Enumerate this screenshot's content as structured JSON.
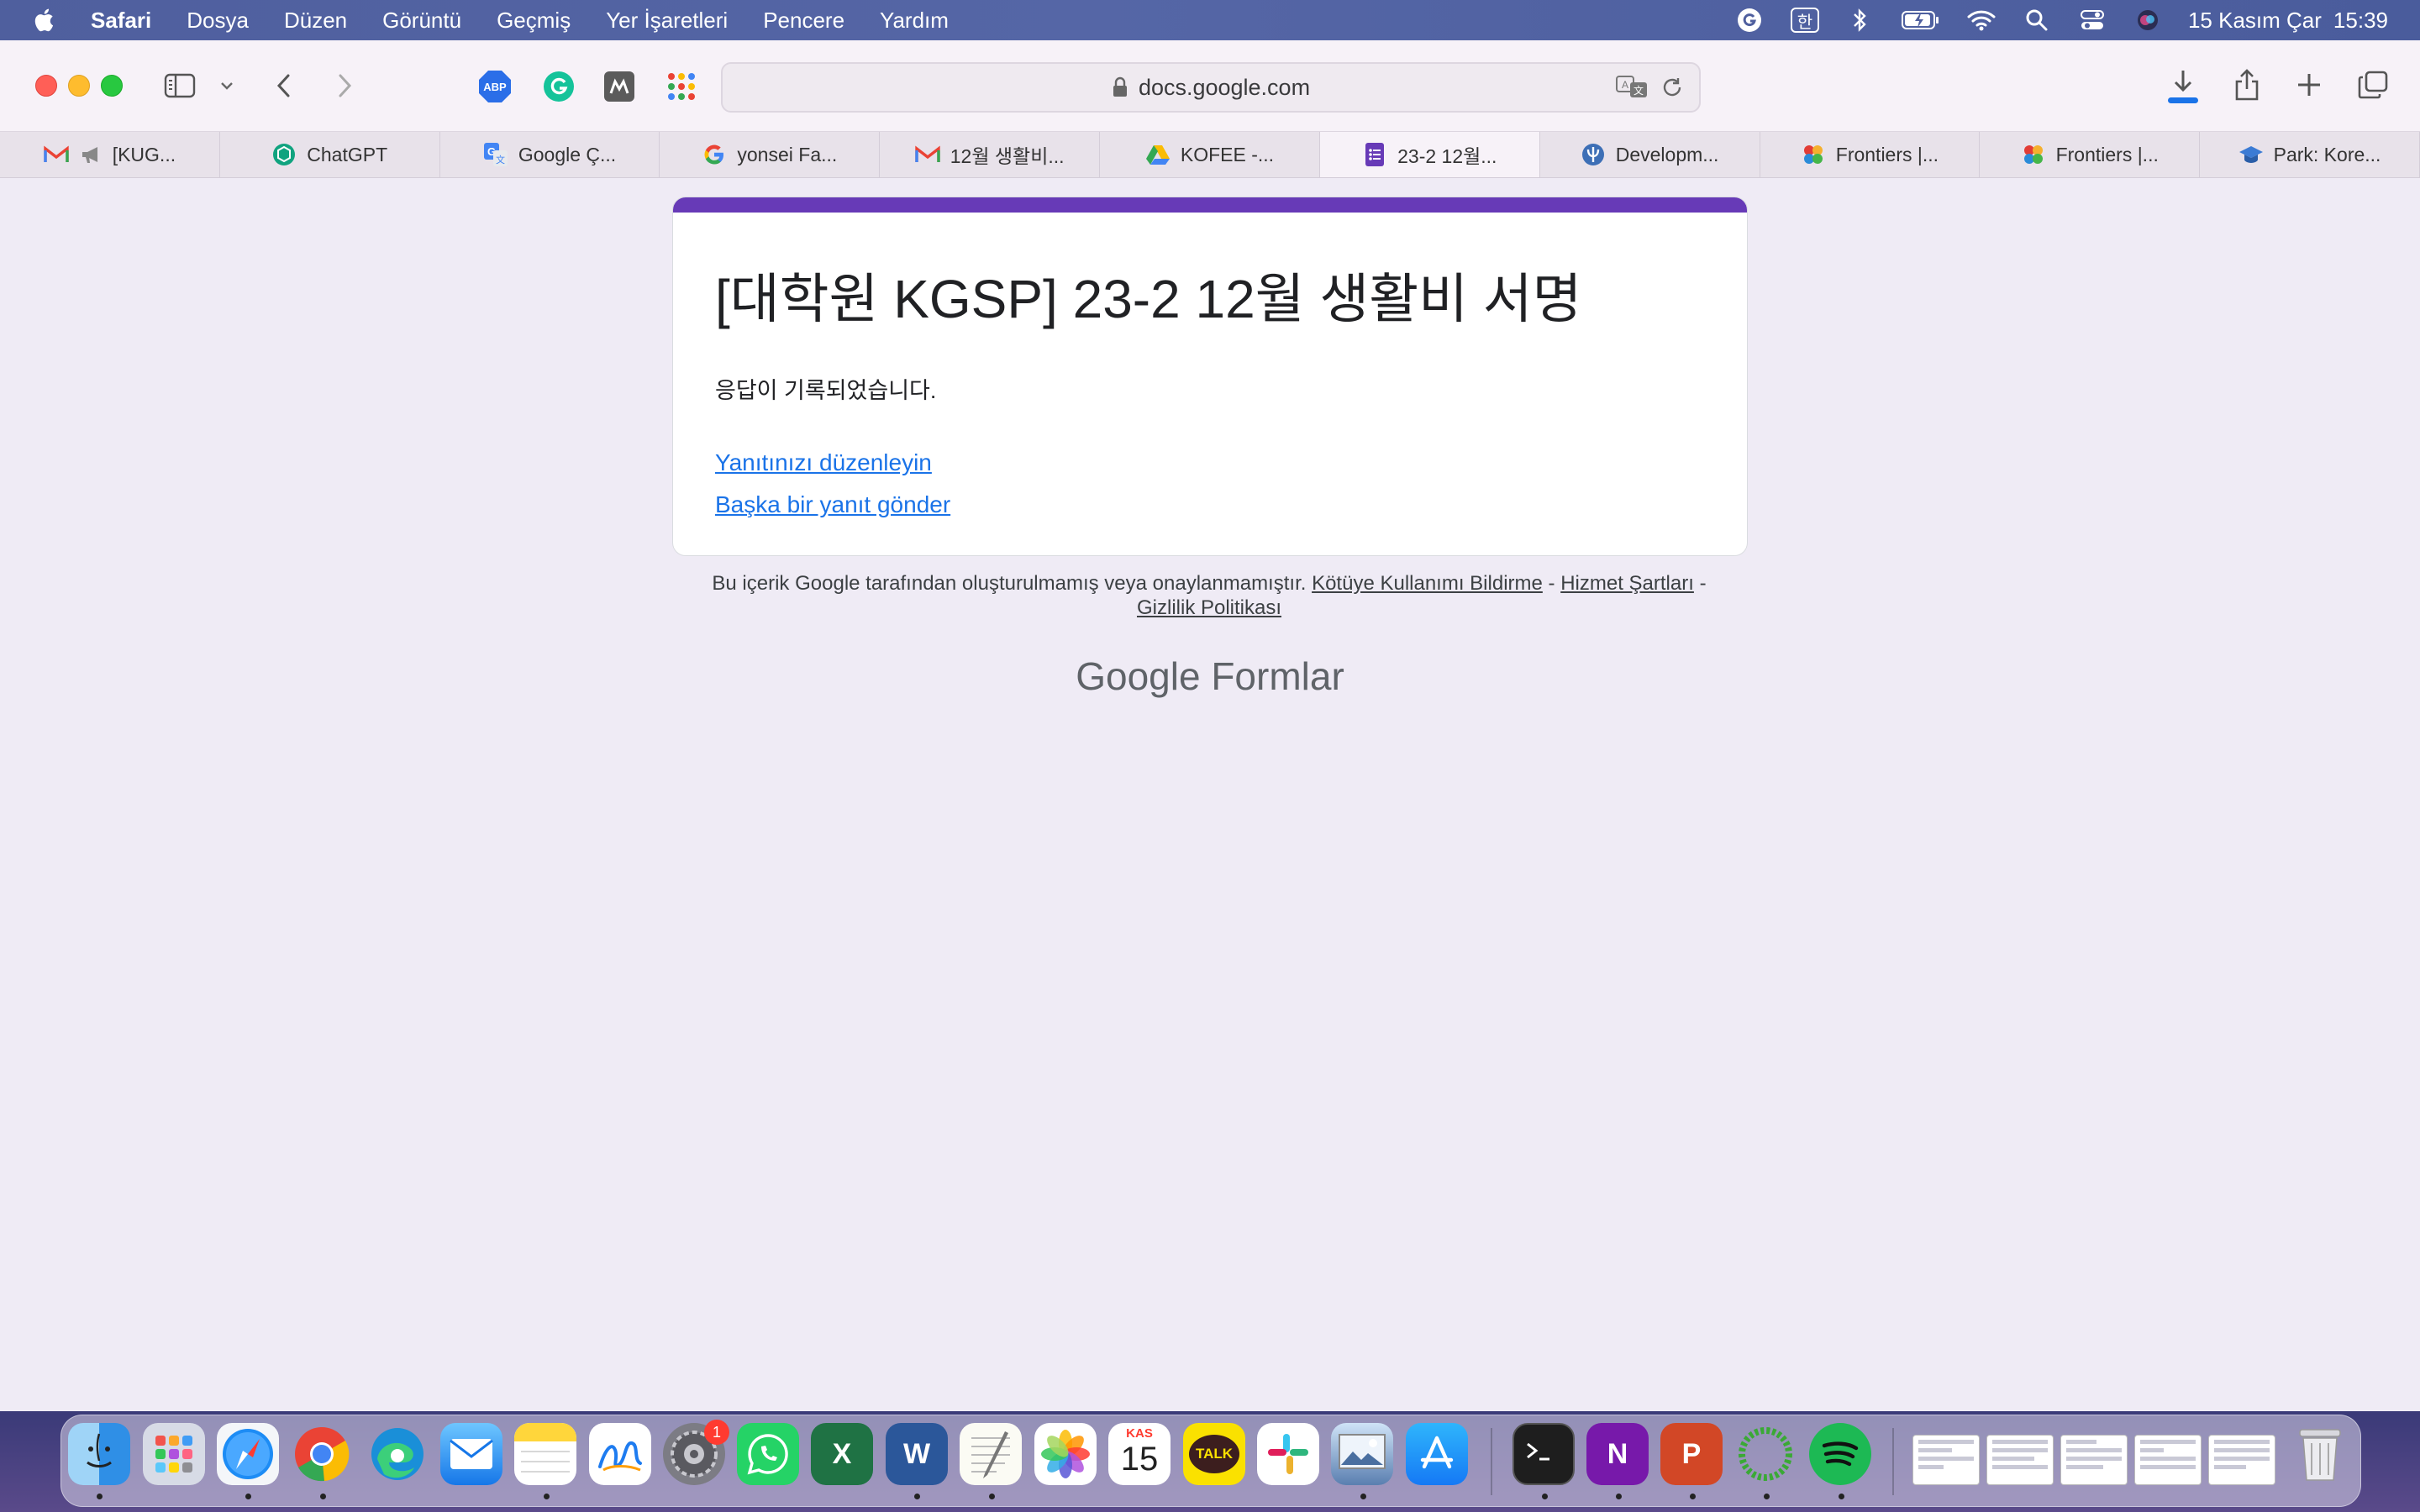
{
  "menubar": {
    "app_name": "Safari",
    "items": [
      "Dosya",
      "Düzen",
      "Görüntü",
      "Geçmiş",
      "Yer İşaretleri",
      "Pencere",
      "Yardım"
    ],
    "input_source": "한",
    "date": "15 Kasım Çar",
    "time": "15:39"
  },
  "toolbar": {
    "url": "docs.google.com",
    "extensions": [
      "adblock-plus-icon",
      "grammarly-icon",
      "mendeley-icon",
      "google-apps-icon"
    ]
  },
  "tabs": [
    {
      "label": "[KUG...",
      "icon": "gmail-icon"
    },
    {
      "label": "ChatGPT",
      "icon": "chatgpt-icon"
    },
    {
      "label": "Google Ç...",
      "icon": "google-translate-icon"
    },
    {
      "label": "yonsei Fa...",
      "icon": "google-icon"
    },
    {
      "label": "12월 생활비...",
      "icon": "gmail-icon"
    },
    {
      "label": "KOFEE -...",
      "icon": "google-drive-icon"
    },
    {
      "label": "23-2 12월...",
      "icon": "google-forms-icon",
      "active": true
    },
    {
      "label": "Developm...",
      "icon": "psychology-icon"
    },
    {
      "label": "Frontiers |...",
      "icon": "frontiers-icon"
    },
    {
      "label": "Frontiers |...",
      "icon": "frontiers-icon"
    },
    {
      "label": "Park: Kore...",
      "icon": "graduation-cap-icon"
    }
  ],
  "form": {
    "title": "[대학원 KGSP] 23-2 12월 생활비 서명",
    "confirmation": "응답이 기록되었습니다.",
    "edit_link": "Yanıtınızı düzenleyin",
    "another_link": "Başka bir yanıt gönder",
    "accent_color": "#673ab7"
  },
  "footer": {
    "disclaimer": "Bu içerik Google tarafından oluşturulmamış veya onaylanmamıştır.",
    "report_abuse": "Kötüye Kullanımı Bildirme",
    "terms": "Hizmet Şartları",
    "privacy": "Gizlilik Politikası",
    "separator": "-",
    "logo_google": "Google",
    "logo_forms": "Formlar"
  },
  "dock": {
    "calendar_month": "KAS",
    "calendar_day": "15",
    "settings_badge": "1",
    "kakao_label": "TALK",
    "excel_letter": "X",
    "word_letter": "W",
    "onenote_letter": "N",
    "powerpoint_letter": "P"
  }
}
